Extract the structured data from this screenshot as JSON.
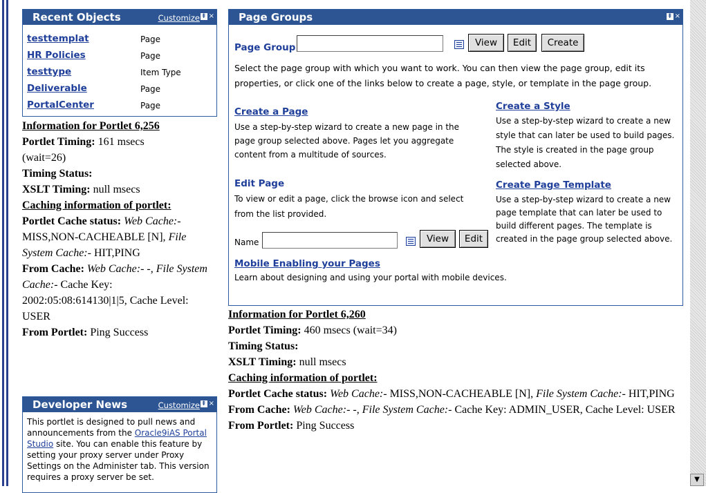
{
  "recent_objects": {
    "title": "Recent Objects",
    "customize": "Customize",
    "items": [
      {
        "name": "testtemplat",
        "type": "Page"
      },
      {
        "name": "HR Policies",
        "type": "Page"
      },
      {
        "name": "testtype",
        "type": "Item Type"
      },
      {
        "name": "Deliverable",
        "type": "Page"
      },
      {
        "name": "PortalCenter",
        "type": "Page"
      }
    ]
  },
  "info_left": {
    "heading": "Information for Portlet 6,256",
    "timing_label": "Portlet Timing:",
    "timing_value": "161 msecs",
    "timing_wait": "(wait=26)",
    "timing_status_label": "Timing Status:",
    "xslt_label": "XSLT Timing:",
    "xslt_value": "null msecs",
    "caching_heading": "Caching information of portlet:",
    "cache_status_label": "Portlet Cache status:",
    "cache_status_value": "Web Cache:- MISS,NON-CACHEABLE [N], File System Cache:- HIT,PING",
    "from_cache_label": "From Cache:",
    "from_cache_value": "Web Cache:- -, File System Cache:- Cache Key: 2002:05:08:614130|1|5, Cache Level: USER",
    "from_portlet_label": "From Portlet:",
    "from_portlet_value": "Ping Success"
  },
  "developer_news": {
    "title": "Developer News",
    "customize": "Customize",
    "text_before": "This portlet is designed to pull news and announcements from the ",
    "link": "Oracle9iAS Portal Studio",
    "text_after": " site. You can enable this feature by setting your proxy server under Proxy Settings on the Administer tab. This version requires a proxy server be set."
  },
  "page_groups": {
    "title": "Page Groups",
    "page_group_label": "Page Group",
    "page_group_value": "",
    "view": "View",
    "edit": "Edit",
    "create": "Create",
    "description": "Select the page group with which you want to work. You can then view the page group, edit its properties, or click one of the links below to create a page, style, or template in the page group.",
    "create_page": {
      "title": "Create a Page",
      "text": "Use a step-by-step wizard to create a new page in the page group selected above. Pages let you aggregate content from a multitude of sources."
    },
    "create_style": {
      "title": "Create a Style",
      "text": "Use a step-by-step wizard to create a new style that can later be used to build pages. The style is created in the page group selected above."
    },
    "edit_page": {
      "title": "Edit Page",
      "text": "To view or edit a page, click the browse icon and select from the list provided.",
      "name_label": "Name",
      "name_value": ""
    },
    "create_template": {
      "title": "Create Page Template",
      "text": "Use a step-by-step wizard to create a new page template that can later be used to build different pages. The template is created in the page group selected above."
    },
    "mobile": {
      "title": "Mobile Enabling your Pages",
      "text": "Learn about designing and using your portal with mobile devices."
    }
  },
  "info_right": {
    "heading": "Information for Portlet 6,260",
    "timing_label": "Portlet Timing:",
    "timing_value": "460 msecs (wait=34)",
    "timing_status_label": "Timing Status:",
    "xslt_label": "XSLT Timing:",
    "xslt_value": "null msecs",
    "caching_heading": "Caching information of portlet:",
    "cache_status_label": "Portlet Cache status:",
    "from_cache_label": "From Cache:",
    "from_portlet_label": "From Portlet:",
    "from_portlet_value": "Ping Success"
  },
  "icons": {
    "pin": "pin-icon",
    "close": "close-icon",
    "browse": "browse-list-icon",
    "scroll_down": "scroll-down-arrow-icon"
  }
}
